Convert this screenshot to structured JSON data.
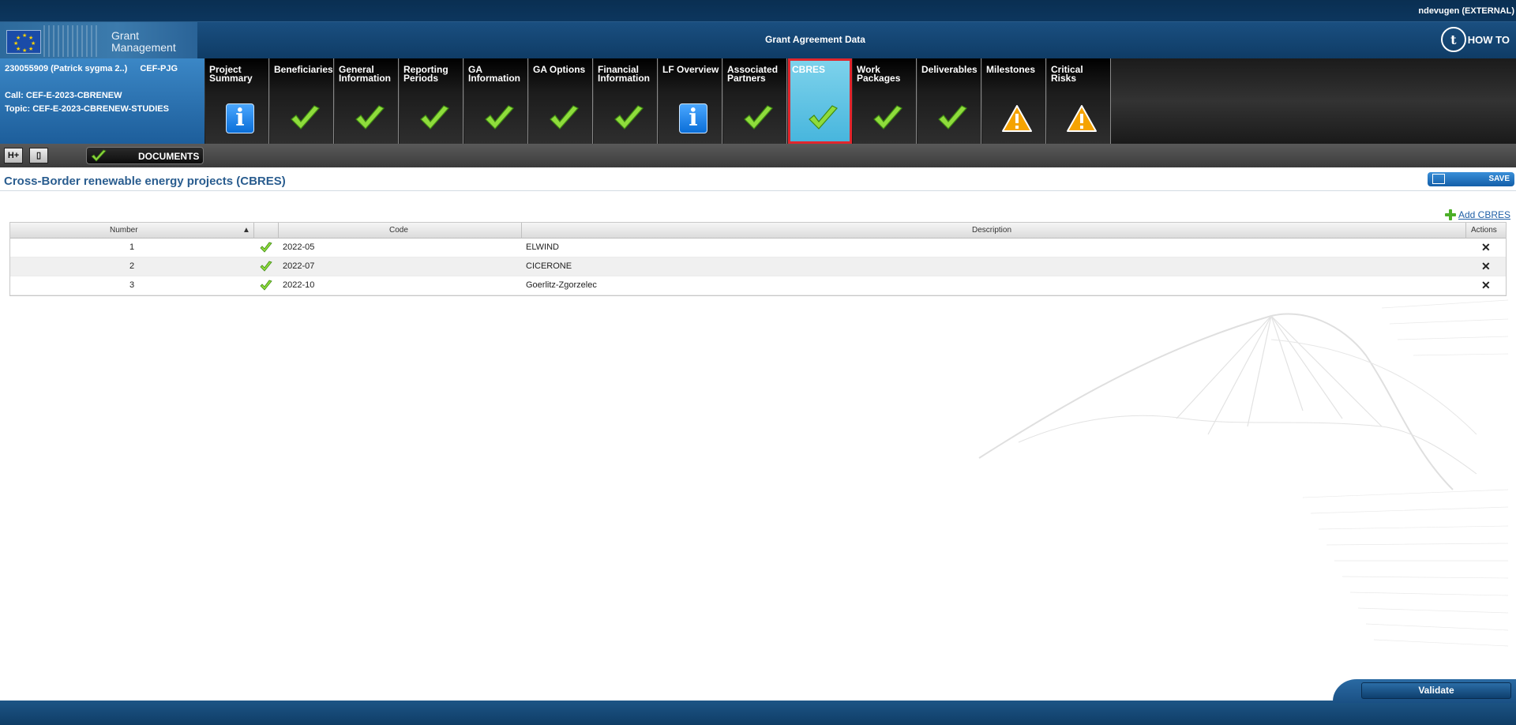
{
  "user": "ndevugen (EXTERNAL)",
  "logo": {
    "line1": "Grant",
    "line2": "Management"
  },
  "header_title": "Grant Agreement Data",
  "howto": {
    "icon": "how-to-icon",
    "label": "HOW TO"
  },
  "project": {
    "id": "230055909 (Patrick sygma 2..)",
    "program": "CEF-PJG",
    "call": "Call: CEF-E-2023-CBRENEW",
    "topic": "Topic: CEF-E-2023-CBRENEW-STUDIES"
  },
  "tabs": [
    {
      "label": "Project Summary",
      "status": "info"
    },
    {
      "label": "Beneficiaries",
      "status": "check"
    },
    {
      "label": "General Information",
      "status": "check"
    },
    {
      "label": "Reporting Periods",
      "status": "check"
    },
    {
      "label": "GA Information",
      "status": "check"
    },
    {
      "label": "GA Options",
      "status": "check"
    },
    {
      "label": "Financial Information",
      "status": "check"
    },
    {
      "label": "LF Overview",
      "status": "info"
    },
    {
      "label": "Associated Partners",
      "status": "check"
    },
    {
      "label": "CBRES",
      "status": "check",
      "active": true
    },
    {
      "label": "Work Packages",
      "status": "check"
    },
    {
      "label": "Deliverables",
      "status": "check"
    },
    {
      "label": "Milestones",
      "status": "warning"
    },
    {
      "label": "Critical Risks",
      "status": "warning"
    }
  ],
  "toolbar": {
    "documents_label": "DOCUMENTS"
  },
  "page_title": "Cross-Border renewable energy projects (CBRES)",
  "save_label": "SAVE",
  "add_label": "Add CBRES",
  "table": {
    "headers": {
      "number": "Number",
      "code": "Code",
      "description": "Description",
      "actions": "Actions"
    },
    "rows": [
      {
        "number": "1",
        "code": "2022-05",
        "description": "ELWIND"
      },
      {
        "number": "2",
        "code": "2022-07",
        "description": "CICERONE"
      },
      {
        "number": "3",
        "code": "2022-10",
        "description": "Goerlitz-Zgorzelec"
      }
    ]
  },
  "validate_label": "Validate",
  "colors": {
    "accent": "#2a5d8f",
    "active_tab": "#5cc3e6",
    "highlight": "#e0262d",
    "check": "#7ed321",
    "warning": "#f5a300"
  }
}
